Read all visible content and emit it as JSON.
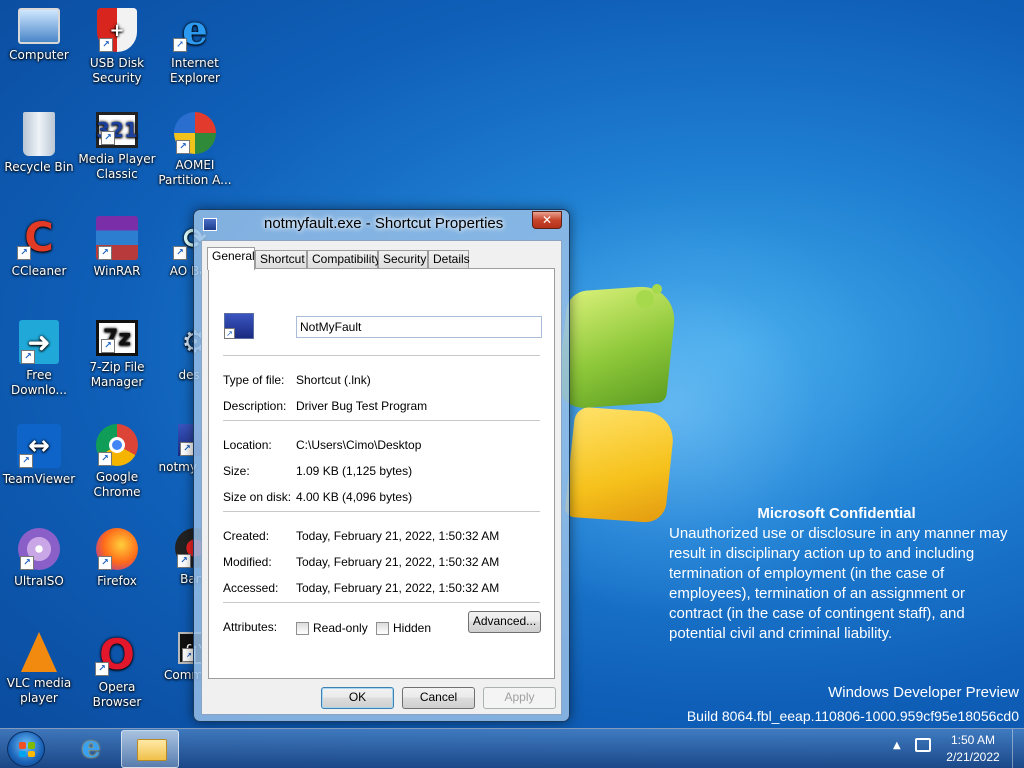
{
  "desktop": {
    "icons": [
      {
        "label": "Computer"
      },
      {
        "label": "USB Disk Security"
      },
      {
        "label": "Internet Explorer"
      },
      {
        "label": "Recycle Bin"
      },
      {
        "label": "Media Player Classic"
      },
      {
        "label": "AOMEI Partition A..."
      },
      {
        "label": "CCleaner"
      },
      {
        "label": "WinRAR"
      },
      {
        "label": "AO Back"
      },
      {
        "label": "Free Downlo..."
      },
      {
        "label": "7-Zip File Manager"
      },
      {
        "label": "deskt"
      },
      {
        "label": "TeamViewer"
      },
      {
        "label": "Google Chrome"
      },
      {
        "label": "notmy - Sho"
      },
      {
        "label": "UltraISO"
      },
      {
        "label": "Firefox"
      },
      {
        "label": "Banc"
      },
      {
        "label": "VLC media player"
      },
      {
        "label": "Opera Browser"
      },
      {
        "label": "Comm Pro"
      }
    ]
  },
  "dialog": {
    "title": "notmyfault.exe - Shortcut Properties",
    "close_label": "✕",
    "tabs": [
      {
        "label": "General"
      },
      {
        "label": "Shortcut"
      },
      {
        "label": "Compatibility"
      },
      {
        "label": "Security"
      },
      {
        "label": "Details"
      }
    ],
    "name_value": "NotMyFault",
    "fields": {
      "type_label": "Type of file:",
      "type_value": "Shortcut (.lnk)",
      "desc_label": "Description:",
      "desc_value": "Driver Bug Test Program",
      "location_label": "Location:",
      "location_value": "C:\\Users\\Cimo\\Desktop",
      "size_label": "Size:",
      "size_value": "1.09 KB (1,125 bytes)",
      "disk_label": "Size on disk:",
      "disk_value": "4.00 KB (4,096 bytes)",
      "created_label": "Created:",
      "created_value": "Today, February 21, 2022, 1:50:32 AM",
      "modified_label": "Modified:",
      "modified_value": "Today, February 21, 2022, 1:50:32 AM",
      "accessed_label": "Accessed:",
      "accessed_value": "Today, February 21, 2022, 1:50:32 AM",
      "attributes_label": "Attributes:"
    },
    "readonly_label": "Read-only",
    "hidden_label": "Hidden",
    "advanced_label": "Advanced...",
    "ok_label": "OK",
    "cancel_label": "Cancel",
    "apply_label": "Apply"
  },
  "notice": {
    "title": "Microsoft Confidential",
    "body": "Unauthorized use or disclosure in any manner may result in disciplinary action up to and including termination of employment (in the case of employees), termination of an assignment or contract (in the case of contingent staff), and potential civil and criminal liability."
  },
  "watermark": {
    "product": "Windows Developer Preview",
    "build": "Build 8064.fbl_eeap.110806-1000.959cf95e18056cd0"
  },
  "taskbar": {
    "time": "1:50 AM",
    "date": "2/21/2022",
    "tray_arrow": "▲"
  },
  "colors": {
    "accent": "#1f7fd2",
    "close_red": "#c7452b"
  }
}
